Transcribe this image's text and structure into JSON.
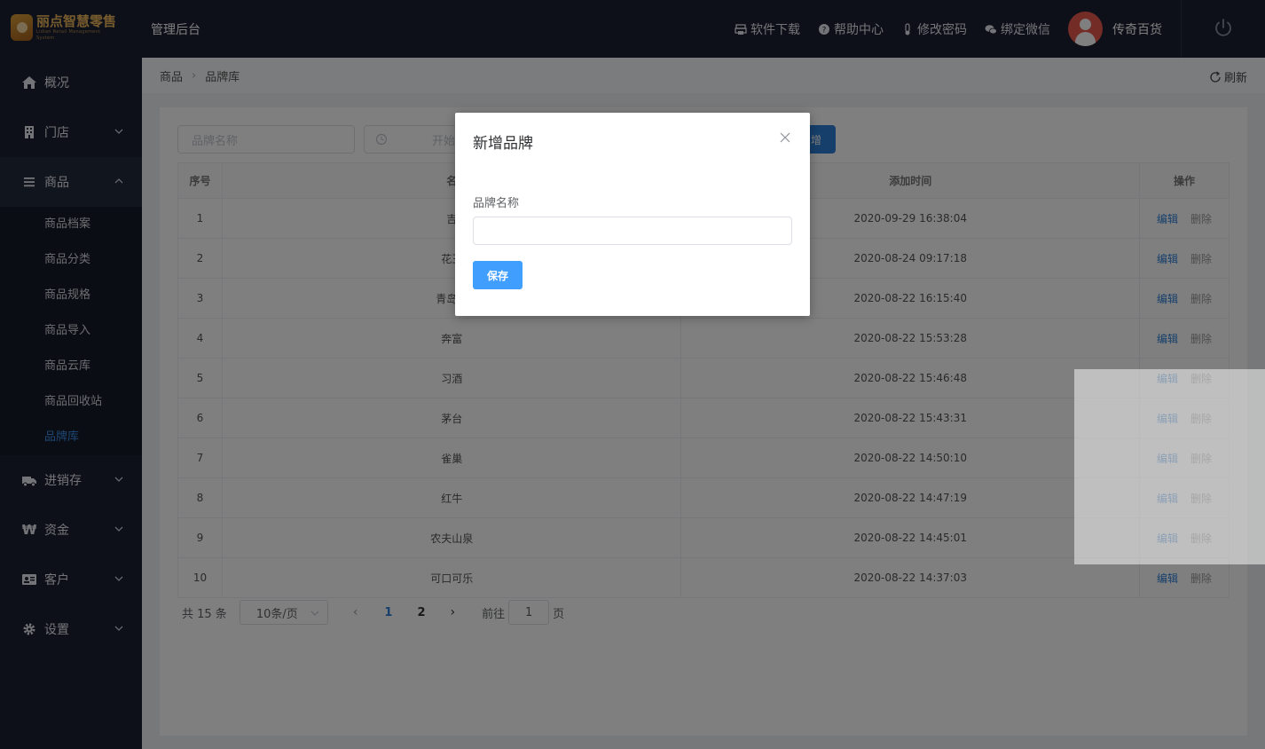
{
  "header": {
    "logo_text": "丽点智慧零售",
    "logo_subtext": "Lidian Retail Management System",
    "admin_title": "管理后台",
    "links": [
      "软件下载",
      "帮助中心",
      "修改密码",
      "绑定微信"
    ],
    "username": "传奇百货"
  },
  "sidebar": {
    "items": [
      {
        "label": "概况"
      },
      {
        "label": "门店"
      },
      {
        "label": "商品"
      },
      {
        "label": "进销存"
      },
      {
        "label": "资金"
      },
      {
        "label": "客户"
      },
      {
        "label": "设置"
      }
    ],
    "currency_glyph": "₩",
    "submenu": [
      "商品档案",
      "商品分类",
      "商品规格",
      "商品导入",
      "商品云库",
      "商品回收站",
      "品牌库"
    ]
  },
  "breadcrumb": {
    "parent": "商品",
    "current": "品牌库",
    "refresh_label": "刷新"
  },
  "filter": {
    "brand_placeholder": "品牌名称",
    "date_placeholder": "开始",
    "add_label": "增"
  },
  "table": {
    "headers": [
      "序号",
      "名",
      "添加时间",
      "操作"
    ],
    "edit_label": "编辑",
    "delete_label": "删除",
    "rows": [
      {
        "idx": "1",
        "name": "吉",
        "time": "2020-09-29 16:38:04"
      },
      {
        "idx": "2",
        "name": "花王",
        "time": "2020-08-24 09:17:18"
      },
      {
        "idx": "3",
        "name": "青岛啤",
        "time": "2020-08-22 16:15:40"
      },
      {
        "idx": "4",
        "name": "奔富",
        "time": "2020-08-22 15:53:28"
      },
      {
        "idx": "5",
        "name": "习酒",
        "time": "2020-08-22 15:46:48"
      },
      {
        "idx": "6",
        "name": "茅台",
        "time": "2020-08-22 15:43:31"
      },
      {
        "idx": "7",
        "name": "雀巢",
        "time": "2020-08-22 14:50:10"
      },
      {
        "idx": "8",
        "name": "红牛",
        "time": "2020-08-22 14:47:19"
      },
      {
        "idx": "9",
        "name": "农夫山泉",
        "time": "2020-08-22 14:45:01"
      },
      {
        "idx": "10",
        "name": "可口可乐",
        "time": "2020-08-22 14:37:03"
      }
    ]
  },
  "pagination": {
    "total": "共 15 条",
    "page_size": "10条/页",
    "prev_glyph": "‹",
    "next_glyph": "›",
    "pages": [
      "1",
      "2"
    ],
    "goto_label": "前往",
    "goto_value": "1",
    "page_unit": "页"
  },
  "modal": {
    "title": "新增品牌",
    "field_label": "品牌名称",
    "field_value": "",
    "save_label": "保存"
  },
  "colors": {
    "sidebar_bg": "#1b2133",
    "accent": "#2d7fd7",
    "primary_button": "#409eff"
  }
}
